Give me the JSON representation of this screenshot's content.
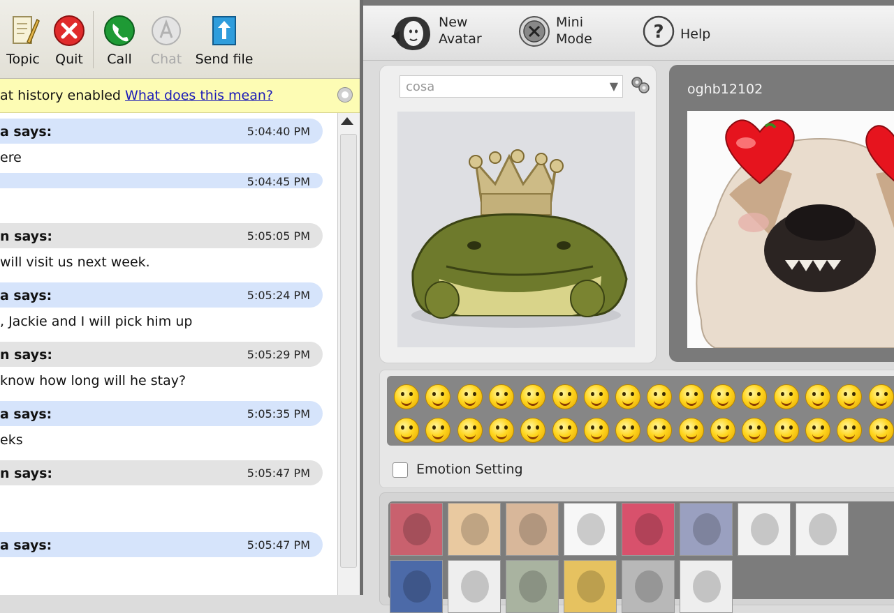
{
  "toolbar": {
    "buttons": [
      {
        "label": "Topic",
        "icon": "topic-icon",
        "enabled": true
      },
      {
        "label": "Quit",
        "icon": "quit-icon",
        "enabled": true
      },
      {
        "label": "Call",
        "icon": "call-icon",
        "enabled": true
      },
      {
        "label": "Chat",
        "icon": "chat-icon",
        "enabled": false
      },
      {
        "label": "Send file",
        "icon": "send-file-icon",
        "enabled": true
      }
    ]
  },
  "history_bar": {
    "text": "at history enabled",
    "link": "What does this mean?"
  },
  "messages": [
    {
      "sender": "a says:",
      "time": "5:04:40 PM",
      "body": "ere",
      "style": "blue"
    },
    {
      "sender": "",
      "time": "5:04:45 PM",
      "body": "",
      "style": "blue"
    },
    {
      "sender": "n says:",
      "time": "5:05:05 PM",
      "body": "will visit us next week.",
      "style": "gray"
    },
    {
      "sender": "a says:",
      "time": "5:05:24 PM",
      "body": ", Jackie and I will pick him up",
      "style": "blue"
    },
    {
      "sender": "n says:",
      "time": "5:05:29 PM",
      "body": "know how long will he stay?",
      "style": "gray"
    },
    {
      "sender": "a says:",
      "time": "5:05:35 PM",
      "body": "eks",
      "style": "blue"
    },
    {
      "sender": "n says:",
      "time": "5:05:47 PM",
      "body": "",
      "style": "gray"
    },
    {
      "sender": "a says:",
      "time": "5:05:47 PM",
      "body": "",
      "style": "blue"
    }
  ],
  "right_toolbar": {
    "new_avatar_line1": "New",
    "new_avatar_line2": "Avatar",
    "mini_mode_line1": "Mini",
    "mini_mode_line2": "Mode",
    "help": "Help"
  },
  "my_avatar": {
    "selected": "cosa",
    "image": "frog-with-crown"
  },
  "peer": {
    "name": "oghb12102",
    "image": "bulldog-with-heart-eyes"
  },
  "emoticons": {
    "setting_label": "Emotion Setting",
    "row1_count": 16,
    "row2_count": 16
  },
  "gallery": {
    "thumbnails": [
      "woman-cartoon",
      "blonde-girl",
      "baby",
      "red-bird",
      "dog-face",
      "bulldog",
      "cartoon-man",
      "green-creature",
      "boy-glasses",
      "skull",
      "frog-king",
      "cat",
      "gray-dog",
      "white-dog"
    ]
  },
  "colors": {
    "bubble_blue": "#d6e4fb",
    "bubble_gray": "#e3e3e3",
    "history_bar": "#fdfcb4",
    "link": "#1a1ab8"
  }
}
